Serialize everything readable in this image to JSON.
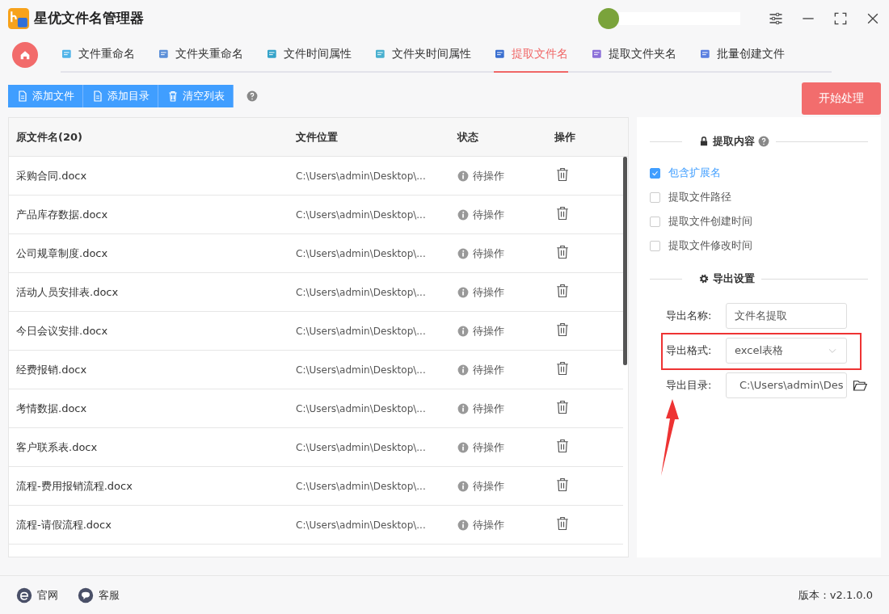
{
  "window": {
    "title": "星优文件名管理器"
  },
  "tabs": [
    {
      "label": "文件重命名",
      "selected": false
    },
    {
      "label": "文件夹重命名",
      "selected": false
    },
    {
      "label": "文件时间属性",
      "selected": false
    },
    {
      "label": "文件夹时间属性",
      "selected": false
    },
    {
      "label": "提取文件名",
      "selected": true
    },
    {
      "label": "提取文件夹名",
      "selected": false
    },
    {
      "label": "批量创建文件",
      "selected": false
    }
  ],
  "toolbar": {
    "buttons": [
      "添加文件",
      "添加目录",
      "清空列表"
    ],
    "start_button": "开始处理"
  },
  "table": {
    "columns": [
      "原文件名(20)",
      "文件位置",
      "状态",
      "操作"
    ],
    "rows": [
      {
        "name": "采购合同.docx",
        "location": "C:\\Users\\admin\\Desktop\\...",
        "status": "待操作"
      },
      {
        "name": "产品库存数据.docx",
        "location": "C:\\Users\\admin\\Desktop\\...",
        "status": "待操作"
      },
      {
        "name": "公司规章制度.docx",
        "location": "C:\\Users\\admin\\Desktop\\...",
        "status": "待操作"
      },
      {
        "name": "活动人员安排表.docx",
        "location": "C:\\Users\\admin\\Desktop\\...",
        "status": "待操作"
      },
      {
        "name": "今日会议安排.docx",
        "location": "C:\\Users\\admin\\Desktop\\...",
        "status": "待操作"
      },
      {
        "name": "经费报销.docx",
        "location": "C:\\Users\\admin\\Desktop\\...",
        "status": "待操作"
      },
      {
        "name": "考情数据.docx",
        "location": "C:\\Users\\admin\\Desktop\\...",
        "status": "待操作"
      },
      {
        "name": "客户联系表.docx",
        "location": "C:\\Users\\admin\\Desktop\\...",
        "status": "待操作"
      },
      {
        "name": "流程-费用报销流程.docx",
        "location": "C:\\Users\\admin\\Desktop\\...",
        "status": "待操作"
      },
      {
        "name": "流程-请假流程.docx",
        "location": "C:\\Users\\admin\\Desktop\\...",
        "status": "待操作"
      }
    ]
  },
  "panel": {
    "extract_title": "提取内容",
    "options": [
      {
        "label": "包含扩展名",
        "checked": true
      },
      {
        "label": "提取文件路径",
        "checked": false
      },
      {
        "label": "提取文件创建时间",
        "checked": false
      },
      {
        "label": "提取文件修改时间",
        "checked": false
      }
    ],
    "export_title": "导出设置",
    "fields": [
      {
        "kind": "text",
        "label": "导出名称:",
        "value": "文件名提取",
        "highlighted": false
      },
      {
        "kind": "select",
        "label": "导出格式:",
        "value": "excel表格",
        "highlighted": true
      },
      {
        "kind": "folder",
        "label": "导出目录:",
        "value": "C:\\Users\\admin\\Des",
        "highlighted": false
      }
    ]
  },
  "footer": {
    "links": [
      "官网",
      "客服"
    ],
    "version": "版本：v2.1.0.0"
  }
}
